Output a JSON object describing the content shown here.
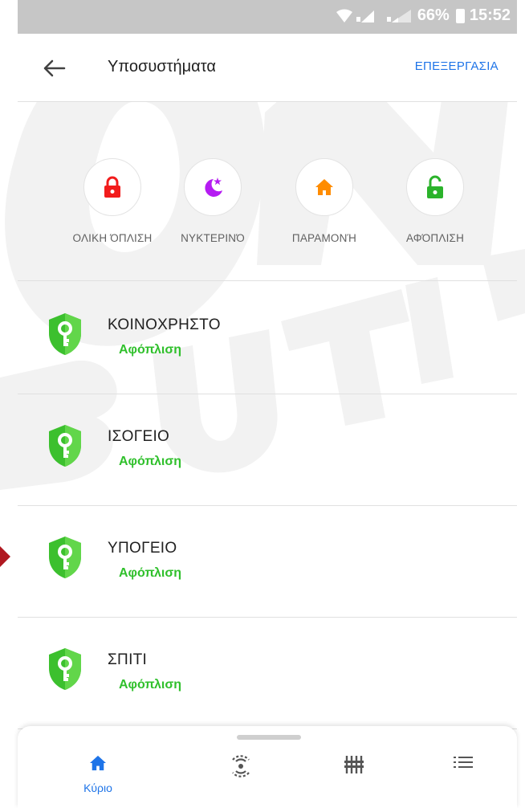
{
  "status_bar": {
    "battery": "66%",
    "time": "15:52"
  },
  "header": {
    "title": "Υποσυστήματα",
    "edit_label": "ΕΠΕΞΕΡΓΑΣΙΑ"
  },
  "modes": [
    {
      "label": "ΟΛΙΚΗ ΌΠΛΙΣΗ",
      "icon": "lock-closed-icon",
      "color": "#f21c1c"
    },
    {
      "label": "ΝΥΚΤΕΡΙΝΌ",
      "icon": "moon-star-icon",
      "color": "#b51cf2"
    },
    {
      "label": "ΠΑΡΑΜΟΝΉ",
      "icon": "home-icon",
      "color": "#ff8c00"
    },
    {
      "label": "ΑΦΌΠΛΙΣΗ",
      "icon": "lock-open-icon",
      "color": "#2bb32b"
    }
  ],
  "subsystems": [
    {
      "name": "ΚΟΙΝΟΧΡΗΣΤΟ",
      "state": "Αφόπλιση"
    },
    {
      "name": "ΙΣΟΓΕΙΟ",
      "state": "Αφόπλιση"
    },
    {
      "name": "ΥΠΟΓΕΙΟ",
      "state": "Αφόπλιση"
    },
    {
      "name": "ΣΠΙΤΙ",
      "state": "Αφόπλιση"
    }
  ],
  "bottom_nav": {
    "items": [
      {
        "label": "Κύριο",
        "icon": "home-icon",
        "active": true
      },
      {
        "label": "",
        "icon": "sensor-icon",
        "active": false
      },
      {
        "label": "",
        "icon": "sliders-icon",
        "active": false
      },
      {
        "label": "",
        "icon": "list-icon",
        "active": false
      }
    ]
  },
  "colors": {
    "accent": "#1e74e8",
    "disarmed": "#30c02c",
    "statusbar": "#c6c6c6"
  }
}
